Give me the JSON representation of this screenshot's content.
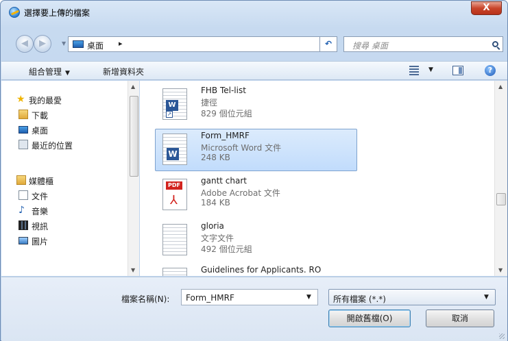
{
  "window": {
    "title": "選擇要上傳的檔案",
    "close_label": "X"
  },
  "navigation": {
    "back_icon": "back-arrow-icon",
    "forward_icon": "forward-arrow-icon",
    "address_location": "桌面",
    "address_separator": "▸",
    "refresh_label": "↶",
    "search_placeholder": "搜尋 桌面"
  },
  "toolbar": {
    "organize_label": "組合管理",
    "new_folder_label": "新增資料夾"
  },
  "sidebar": {
    "favorites_header": "我的最愛",
    "favorites": [
      {
        "label": "下載",
        "icon": "downloads-folder-icon"
      },
      {
        "label": "桌面",
        "icon": "desktop-icon"
      },
      {
        "label": "最近的位置",
        "icon": "recent-places-icon"
      }
    ],
    "libraries_header": "媒體櫃",
    "libraries": [
      {
        "label": "文件",
        "icon": "documents-icon"
      },
      {
        "label": "音樂",
        "icon": "music-icon"
      },
      {
        "label": "視訊",
        "icon": "video-icon"
      },
      {
        "label": "圖片",
        "icon": "pictures-icon"
      }
    ]
  },
  "files": [
    {
      "name": "FHB Tel-list",
      "type": "捷徑",
      "size": "829 個位元組",
      "icon": "shortcut-file-icon",
      "selected": false
    },
    {
      "name": "Form_HMRF",
      "type": "Microsoft Word 文件",
      "size": "248 KB",
      "icon": "word-document-icon",
      "selected": true
    },
    {
      "name": "gantt chart",
      "type": "Adobe Acrobat 文件",
      "size": "184 KB",
      "icon": "pdf-file-icon",
      "selected": false
    },
    {
      "name": "gloria",
      "type": "文字文件",
      "size": "492 個位元組",
      "icon": "text-file-icon",
      "selected": false
    },
    {
      "name": "Guidelines for Applicants. RO",
      "type": "",
      "size": "",
      "icon": "document-file-icon",
      "selected": false
    }
  ],
  "footer": {
    "filename_label": "檔案名稱(N):",
    "filename_value": "Form_HMRF",
    "filter_value": "所有檔案 (*.*)",
    "open_label": "開啟舊檔(O)",
    "cancel_label": "取消"
  },
  "colors": {
    "selection": "#c1dcfc",
    "selection_border": "#7da2ce",
    "chrome": "#c7daf0",
    "close_button": "#c9452b"
  }
}
